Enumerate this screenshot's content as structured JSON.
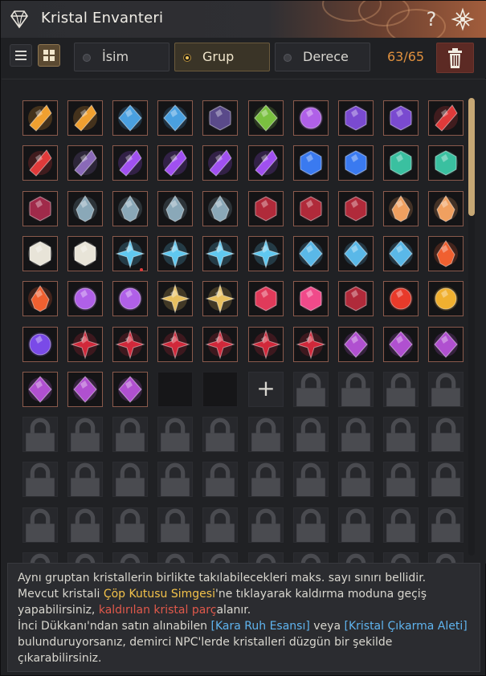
{
  "window": {
    "title": "Kristal Envanteri",
    "help_label": "?"
  },
  "toolbar": {
    "sort_options": [
      {
        "label": "İsim",
        "selected": false
      },
      {
        "label": "Grup",
        "selected": true
      },
      {
        "label": "Derece",
        "selected": false
      }
    ],
    "count": "63/65"
  },
  "crystals": [
    "orange-gold",
    "orange-gold",
    "green-blue",
    "green-blue",
    "dark-violet",
    "green",
    "purple-round",
    "purple-hex",
    "purple-hex",
    "red",
    "red",
    "violet-shard",
    "purple-shard",
    "purple-shard",
    "purple-shard",
    "purple-shard",
    "blue",
    "blue",
    "teal",
    "teal",
    "dark-red-gem",
    "grey-drop",
    "grey-drop",
    "grey-drop",
    "grey-drop",
    "dark-red-cluster",
    "dark-red-cluster",
    "dark-red-cluster",
    "amber-drop",
    "amber-drop",
    "white-hex",
    "white-hex",
    "cyan-star",
    "cyan-star",
    "cyan-star",
    "cyan-star",
    "cyan-diamond",
    "cyan-diamond",
    "cyan-diamond",
    "orange-red-drop",
    "orange-red-drop",
    "purple-round",
    "purple-round",
    "yellow-star",
    "yellow-star",
    "red-shield",
    "pink-crystal",
    "dark-red-cluster",
    "red-round",
    "gold-round",
    "violet-round",
    "red-flower",
    "red-flower",
    "red-flower",
    "red-flower",
    "red-flower",
    "red-flower",
    "violet-lotus",
    "violet-lotus",
    "violet-lotus",
    "violet-lotus",
    "violet-lotus",
    "violet-lotus"
  ],
  "colors": {
    "orange-gold": "#f0a030",
    "green-blue": "#4aa0e0",
    "dark-violet": "#5a4a8a",
    "green": "#7ac040",
    "purple-round": "#b060e8",
    "purple-hex": "#7a4ad0",
    "red": "#e03a3a",
    "violet-shard": "#8a6ab8",
    "purple-shard": "#a050f0",
    "blue": "#3a7af0",
    "teal": "#3ac0a0",
    "dark-red-gem": "#a02a4a",
    "grey-drop": "#8aa8b8",
    "dark-red-cluster": "#b02a3a",
    "amber-drop": "#f0a060",
    "white-hex": "#e8e4d8",
    "cyan-star": "#60c8f0",
    "cyan-diamond": "#5ab8e8",
    "orange-red-drop": "#f06030",
    "yellow-star": "#e8c060",
    "red-shield": "#e03a5a",
    "pink-crystal": "#f04a8a",
    "red-round": "#e83a2a",
    "gold-round": "#f0b030",
    "violet-round": "#7a4ae8",
    "red-flower": "#d0283a",
    "violet-lotus": "#b050d0"
  },
  "slots": {
    "empty_count": 2,
    "add_label": "+"
  },
  "info": {
    "line1": "Aynı gruptan kristallerin birlikte takılabilecekleri maks. sayı sınırı bellidir.",
    "l2_a": "Mevcut kristali ",
    "l2_hl": "Çöp Kutusu Simgesi",
    "l2_b": "'ne tıklayarak kaldırma moduna geçiş yapabilirsiniz, ",
    "l2_red": "kaldırılan kristal parç",
    "l2_c": "alanır.",
    "l3_a": "İnci Dükkanı'ndan satın alınabilen ",
    "l3_blue1": "[Kara Ruh Esansı]",
    "l3_b": " veya ",
    "l3_blue2": "[Kristal Çıkarma Aleti]",
    "l3_c": " bulunduruyorsanız, demirci NPC'lerde kristalleri düzgün bir şekilde çıkarabilirsiniz."
  }
}
